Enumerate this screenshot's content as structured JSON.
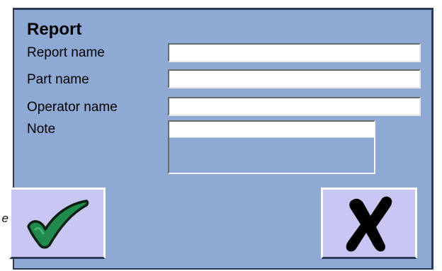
{
  "side_label": "e",
  "dialog": {
    "title": "Report",
    "fields": {
      "report_name": {
        "label": "Report name",
        "value": ""
      },
      "part_name": {
        "label": "Part name",
        "value": ""
      },
      "operator_name": {
        "label": "Operator name",
        "value": ""
      },
      "note": {
        "label": "Note",
        "value": ""
      }
    },
    "buttons": {
      "ok": {
        "icon": "checkmark-icon",
        "color": "#1f8a4c"
      },
      "cancel": {
        "icon": "cross-icon",
        "color": "#000000"
      }
    }
  },
  "colors": {
    "dialog_background": "#8fa9d5",
    "button_background": "#c8c6f2"
  }
}
